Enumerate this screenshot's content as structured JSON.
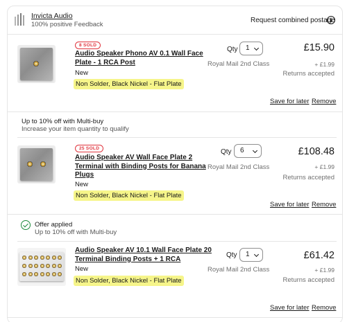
{
  "seller": {
    "name": "Invicta Audio",
    "feedback": "100% positive Feedback",
    "request_postage": "Request combined postage"
  },
  "items": [
    {
      "sold": "8 SOLD",
      "title_line1": "Audio Speaker Phono AV 0.1 Wall Face",
      "title_line2": "Plate - 1 RCA Post",
      "condition": "New",
      "variant": "Non Solder, Black Nickel - Flat Plate",
      "qty_label": "Qty",
      "qty": "1",
      "postage": "Royal Mail 2nd Class",
      "price": "£15.90",
      "shipping": "+ £1.99",
      "returns": "Returns accepted",
      "save": "Save for later",
      "remove": "Remove"
    },
    {
      "sold": "25 SOLD",
      "title_line1": "Audio Speaker AV Wall Face Plate 2",
      "title_line2": "Terminal with Binding Posts for Banana",
      "title_line3": "Plugs",
      "condition": "New",
      "variant": "Non Solder, Black Nickel - Flat Plate",
      "qty_label": "Qty",
      "qty": "6",
      "postage": "Royal Mail 2nd Class",
      "price": "£108.48",
      "shipping": "+ £1.99",
      "returns": "Returns accepted",
      "save": "Save for later",
      "remove": "Remove"
    },
    {
      "title_line1": "Audio Speaker AV 10.1 Wall Face Plate 20",
      "title_line2": "Terminal Binding Posts + 1 RCA",
      "condition": "New",
      "variant": "Non Solder, Black Nickel - Flat Plate",
      "qty_label": "Qty",
      "qty": "1",
      "postage": "Royal Mail 2nd Class",
      "price": "£61.42",
      "shipping": "+ £1.99",
      "returns": "Returns accepted",
      "save": "Save for later",
      "remove": "Remove"
    }
  ],
  "promo": {
    "title": "Up to 10% off with Multi-buy",
    "subtitle": "Increase your item quantity to qualify"
  },
  "offer": {
    "title": "Offer applied",
    "subtitle": "Up to 10% off with Multi-buy"
  },
  "icons": {
    "seller_logo": "seller-logo-icon",
    "info": "info-icon",
    "chevron": "chevron-down-icon",
    "check": "check-circle-icon"
  },
  "colors": {
    "sold_badge": "#e0343d",
    "highlight": "#f6f58a",
    "offer_green": "#1a8a3a"
  }
}
